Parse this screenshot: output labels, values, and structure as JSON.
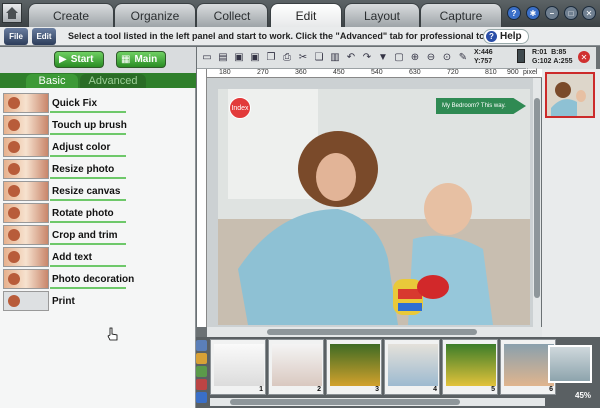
{
  "tabs": [
    {
      "label": "Create"
    },
    {
      "label": "Organize"
    },
    {
      "label": "Collect"
    },
    {
      "label": "Edit"
    },
    {
      "label": "Layout"
    },
    {
      "label": "Capture"
    }
  ],
  "row2": {
    "file_label": "File",
    "edit_label": "Edit",
    "instruction": "Select a tool listed in the left panel and start to work. Click the \"Advanced\" tab for professional tools.",
    "help_label": "Help"
  },
  "left": {
    "start_label": "Start",
    "main_label": "Main",
    "basic_tab": "Basic",
    "advanced_tab": "Advanced",
    "tools": [
      {
        "label": "Quick Fix"
      },
      {
        "label": "Touch up brush"
      },
      {
        "label": "Adjust color"
      },
      {
        "label": "Resize photo"
      },
      {
        "label": "Resize canvas"
      },
      {
        "label": "Rotate photo"
      },
      {
        "label": "Crop and trim"
      },
      {
        "label": "Add text"
      },
      {
        "label": "Photo decoration"
      },
      {
        "label": "Print"
      }
    ]
  },
  "readout": {
    "x": "X:446",
    "y": "Y:757",
    "r": "R:01",
    "b": "B:85",
    "g": "G:102",
    "a": "A:255"
  },
  "ruler_marks": [
    "180",
    "270",
    "360",
    "450",
    "540",
    "630",
    "720",
    "810",
    "900"
  ],
  "ruler_suffix": "pixel",
  "photo": {
    "index_label": "Index",
    "speech_label": "My Bedroom? This way."
  },
  "thumbnails": [
    {
      "num": "1"
    },
    {
      "num": "2"
    },
    {
      "num": "3"
    },
    {
      "num": "4"
    },
    {
      "num": "5"
    },
    {
      "num": "6"
    }
  ],
  "zoom": "45%",
  "colors": {
    "accent_green": "#2f8a2a",
    "selection_red": "#cc2a2a"
  }
}
